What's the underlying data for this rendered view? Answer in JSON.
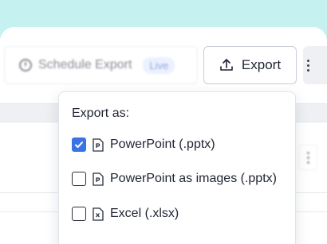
{
  "toolbar": {
    "schedule_label": "Schedule Export",
    "live_badge": "Live",
    "export_label": "Export"
  },
  "export_menu": {
    "title": "Export as:",
    "options": [
      {
        "label": "PowerPoint (.pptx)",
        "checked": true,
        "icon": "powerpoint-file-icon"
      },
      {
        "label": "PowerPoint as images (.pptx)",
        "checked": false,
        "icon": "powerpoint-file-icon"
      },
      {
        "label": "Excel (.xlsx)",
        "checked": false,
        "icon": "excel-file-icon"
      }
    ]
  },
  "colors": {
    "top_band": "#c6f1f1",
    "checkbox_checked": "#3b73e6",
    "live_badge_bg": "#dbe6ff"
  }
}
